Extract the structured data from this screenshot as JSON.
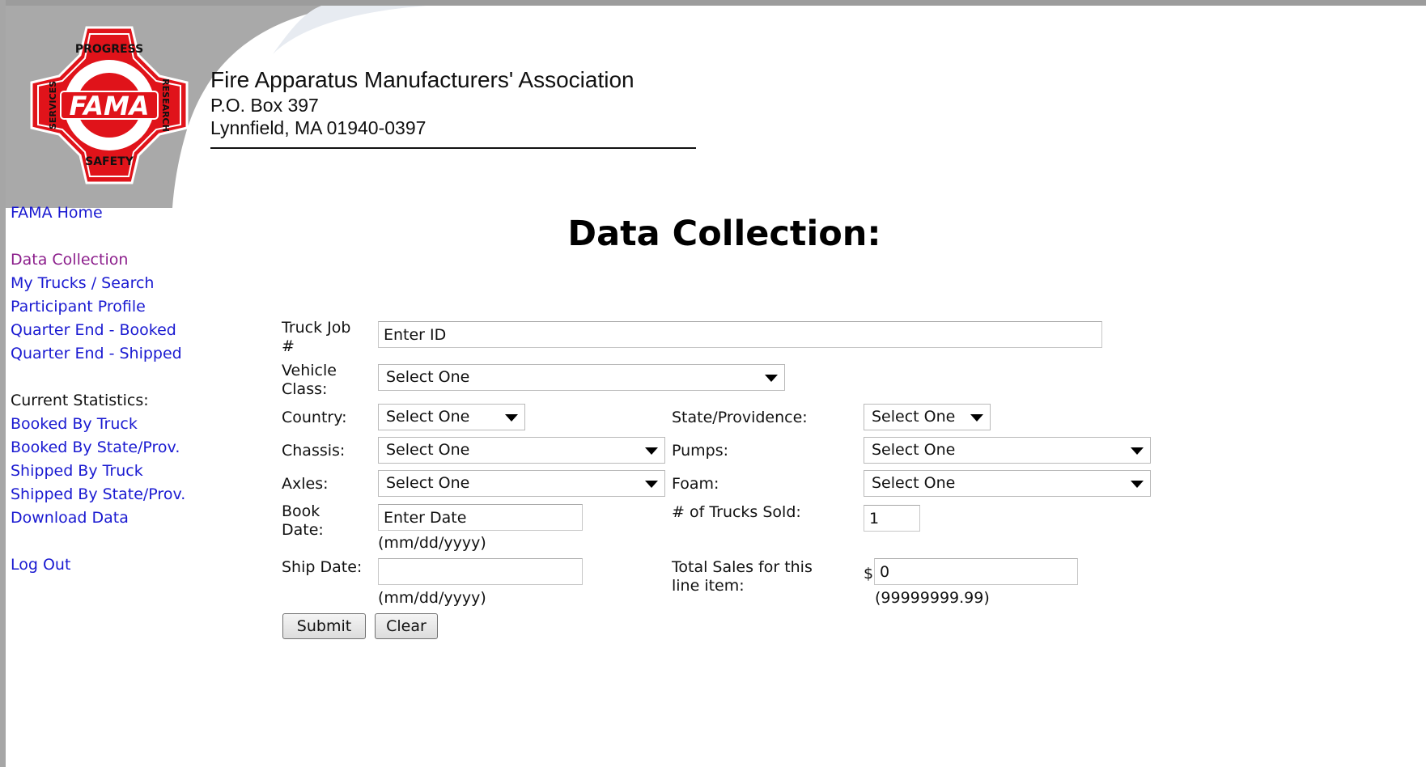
{
  "header": {
    "logo_text": {
      "top": "PROGRESS",
      "center": "FAMA",
      "left": "SERVICES",
      "right": "RESEARCH",
      "bottom": "SAFETY"
    },
    "org_name": "Fire Apparatus Manufacturers' Association",
    "address_line1": "P.O. Box 397",
    "address_line2": "Lynnfield, MA 01940-0397"
  },
  "nav": {
    "home": "FAMA Home",
    "data_collection": "Data Collection",
    "my_trucks": "My Trucks / Search",
    "participant_profile": "Participant Profile",
    "quarter_booked": "Quarter End - Booked",
    "quarter_shipped": "Quarter End - Shipped",
    "stats_heading": "Current Statistics:",
    "booked_truck": "Booked By Truck",
    "booked_state": "Booked By State/Prov.",
    "shipped_truck": "Shipped By Truck",
    "shipped_state": "Shipped By State/Prov.",
    "download": "Download Data",
    "logout": "Log Out"
  },
  "page": {
    "title": "Data Collection:"
  },
  "form": {
    "truck_job_label_1": "Truck Job",
    "truck_job_label_2": "#",
    "truck_job_value": "Enter ID",
    "vehicle_class_label_1": "Vehicle",
    "vehicle_class_label_2": "Class:",
    "vehicle_class_value": "Select One",
    "country_label": "Country:",
    "country_value": "Select One",
    "state_label": "State/Providence:",
    "state_value": "Select One",
    "chassis_label": "Chassis:",
    "chassis_value": "Select One",
    "pumps_label": "Pumps:",
    "pumps_value": "Select One",
    "axles_label": "Axles:",
    "axles_value": "Select One",
    "foam_label": "Foam:",
    "foam_value": "Select One",
    "book_date_label_1": "Book",
    "book_date_label_2": "Date:",
    "book_date_value": "Enter Date",
    "date_format_hint": "(mm/dd/yyyy)",
    "trucks_sold_label": "# of Trucks Sold:",
    "trucks_sold_value": "1",
    "ship_date_label": "Ship Date:",
    "ship_date_value": "",
    "total_sales_label_1": "Total Sales for this",
    "total_sales_label_2": "line item:",
    "currency_symbol": "$",
    "total_sales_value": "0",
    "total_sales_hint": "(99999999.99)",
    "submit_label": "Submit",
    "clear_label": "Clear"
  },
  "colors": {
    "link": "#1a1ad1",
    "visited_link": "#8c1f8c",
    "logo_red": "#e0131a",
    "swoosh_gray": "#a8a8a8"
  }
}
